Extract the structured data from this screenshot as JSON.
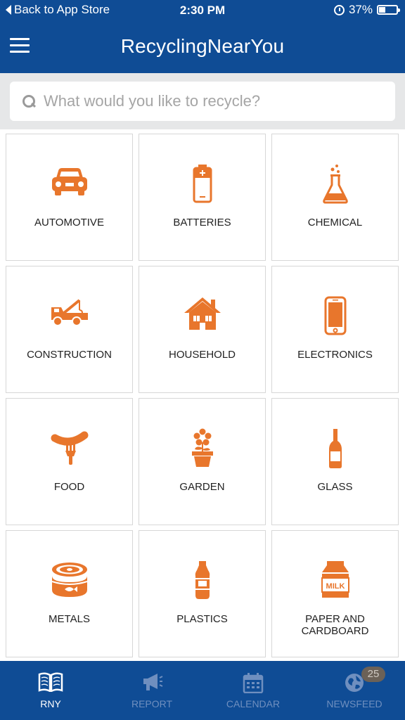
{
  "status_bar": {
    "back_label": "Back to App Store",
    "time": "2:30 PM",
    "battery_text": "37%",
    "battery_level": 0.37
  },
  "nav": {
    "title": "RecyclingNearYou"
  },
  "search": {
    "placeholder": "What would you like to recycle?"
  },
  "colors": {
    "brand_blue": "#0f4c95",
    "accent_orange": "#e8762c",
    "tab_inactive": "#6f8fbf",
    "badge_bg": "#6b6157"
  },
  "categories": [
    {
      "label": "AUTOMOTIVE",
      "icon": "car-icon"
    },
    {
      "label": "BATTERIES",
      "icon": "battery-icon"
    },
    {
      "label": "CHEMICAL",
      "icon": "flask-icon"
    },
    {
      "label": "CONSTRUCTION",
      "icon": "tow-truck-icon"
    },
    {
      "label": "HOUSEHOLD",
      "icon": "house-icon"
    },
    {
      "label": "ELECTRONICS",
      "icon": "smartphone-icon"
    },
    {
      "label": "FOOD",
      "icon": "sausage-fork-icon"
    },
    {
      "label": "GARDEN",
      "icon": "flower-pot-icon"
    },
    {
      "label": "GLASS",
      "icon": "bottle-icon"
    },
    {
      "label": "METALS",
      "icon": "tin-can-icon"
    },
    {
      "label": "PLASTICS",
      "icon": "plastic-bottle-icon"
    },
    {
      "label": "PAPER AND CARDBOARD",
      "icon": "milk-carton-icon",
      "icon_text": "MILK"
    }
  ],
  "tabs": [
    {
      "label": "RNY",
      "icon": "book-icon",
      "active": true
    },
    {
      "label": "REPORT",
      "icon": "megaphone-icon",
      "active": false
    },
    {
      "label": "CALENDAR",
      "icon": "calendar-icon",
      "active": false
    },
    {
      "label": "NEWSFEED",
      "icon": "globe-icon",
      "active": false,
      "badge": "25"
    }
  ]
}
